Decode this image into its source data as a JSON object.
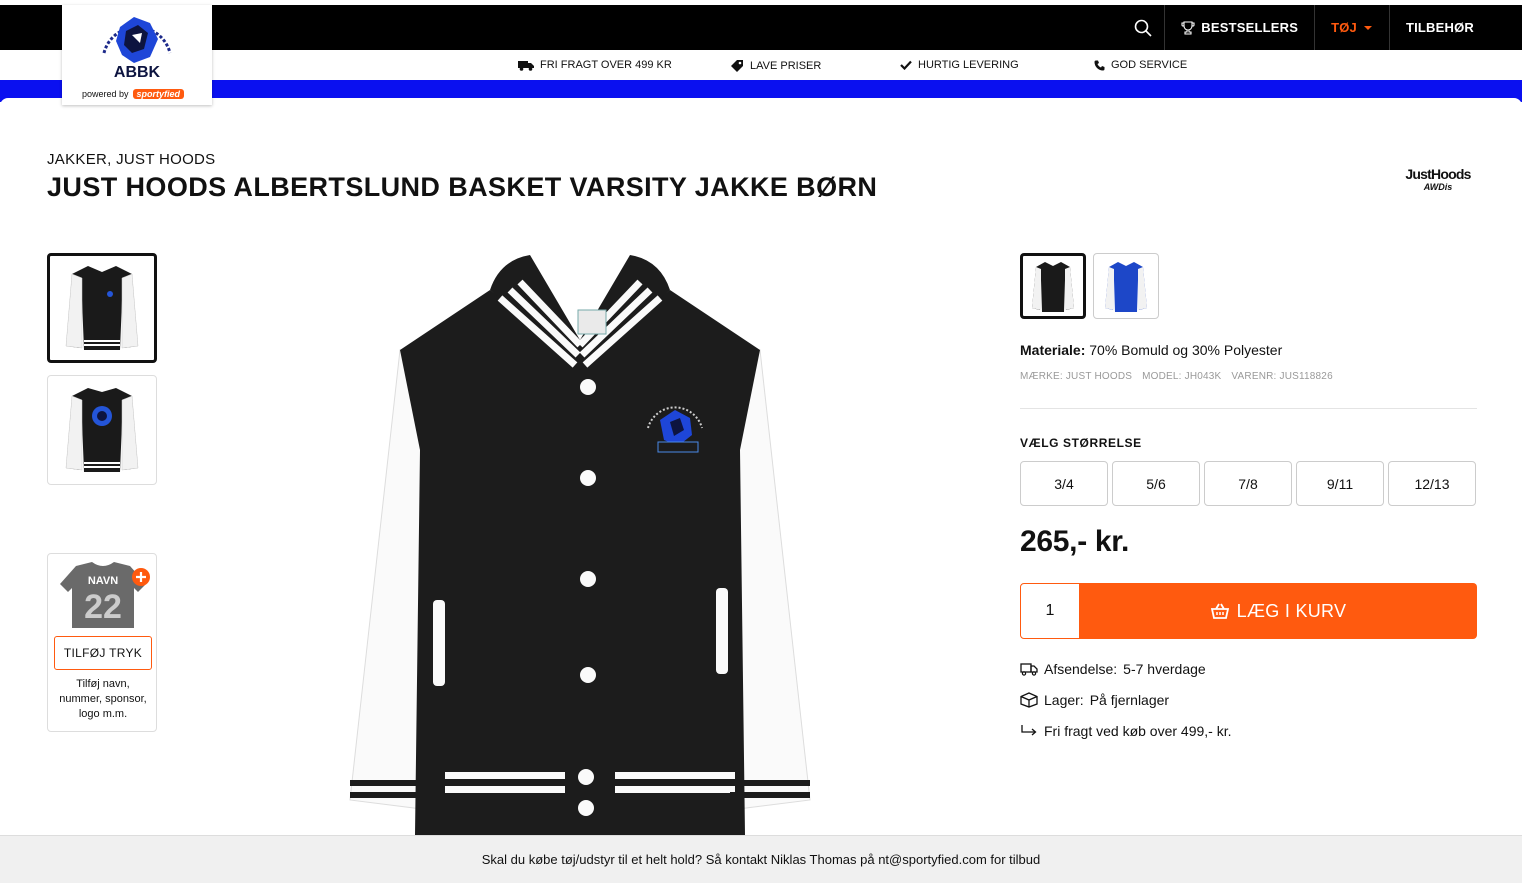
{
  "header": {
    "logo_text": "ABBK",
    "powered_by": "powered by",
    "powered_brand": "sportyfied",
    "nav": [
      {
        "label": "BESTSELLERS",
        "icon": "trophy-icon"
      },
      {
        "label": "TØJ",
        "active": true,
        "icon": "caret-down-icon"
      },
      {
        "label": "TILBEHØR"
      }
    ]
  },
  "usps": [
    {
      "label": "FRI FRAGT OVER 499 KR",
      "icon": "truck-icon"
    },
    {
      "label": "LAVE PRISER",
      "icon": "tag-icon"
    },
    {
      "label": "HURTIG LEVERING",
      "icon": "check-icon"
    },
    {
      "label": "GOD SERVICE",
      "icon": "phone-icon"
    }
  ],
  "product": {
    "breadcrumb": "JAKKER, JUST HOODS",
    "title": "JUST HOODS ALBERTSLUND BASKET VARSITY JAKKE BØRN",
    "brand_logo_line1": "JustHoods",
    "brand_logo_line2": "AWDis",
    "material_label": "Materiale:",
    "material_value": "70% Bomuld og 30% Polyester",
    "meta": [
      "MÆRKE: JUST HOODS",
      "MODEL: JH043K",
      "VARENR: JUS118826"
    ],
    "size_label": "VÆLG STØRRELSE",
    "sizes": [
      "3/4",
      "5/6",
      "7/8",
      "9/11",
      "12/13"
    ],
    "price": "265,- kr.",
    "quantity": "1",
    "add_to_cart": "LÆG I KURV",
    "shipping_label": "Afsendelse:",
    "shipping_value": "5-7 hverdage",
    "stock_label": "Lager:",
    "stock_value": "På fjernlager",
    "free_shipping": "Fri fragt ved køb over 499,- kr."
  },
  "print_box": {
    "shirt_text": "NAVN",
    "shirt_number": "22",
    "button": "TILFØJ TRYK",
    "description": "Tilføj navn, nummer, sponsor, logo m.m."
  },
  "footer": {
    "text": "Skal du købe tøj/udstyr til et helt hold? Så kontakt Niklas Thomas på nt@sportyfied.com for tilbud"
  },
  "colors": {
    "accent": "#ff5a0f",
    "band": "#0a10f0",
    "topbar": "#000000"
  }
}
